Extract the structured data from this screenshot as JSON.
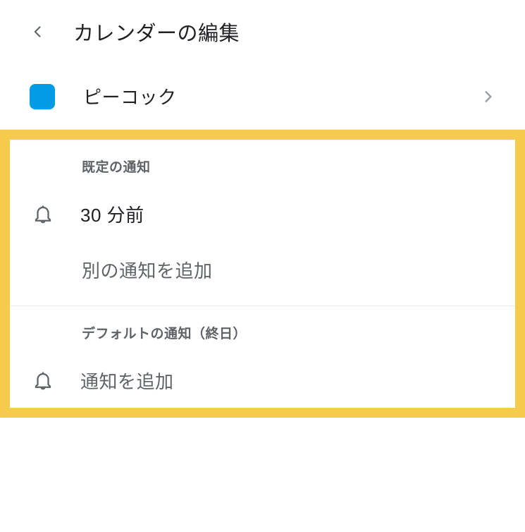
{
  "header": {
    "title": "カレンダーの編集"
  },
  "calendar": {
    "name": "ピーコック",
    "color": "#039be5"
  },
  "sections": {
    "default_notifications": {
      "header": "既定の通知",
      "item": "30 分前",
      "add": "別の通知を追加"
    },
    "all_day_notifications": {
      "header": "デフォルトの通知（終日）",
      "add": "通知を追加"
    }
  }
}
